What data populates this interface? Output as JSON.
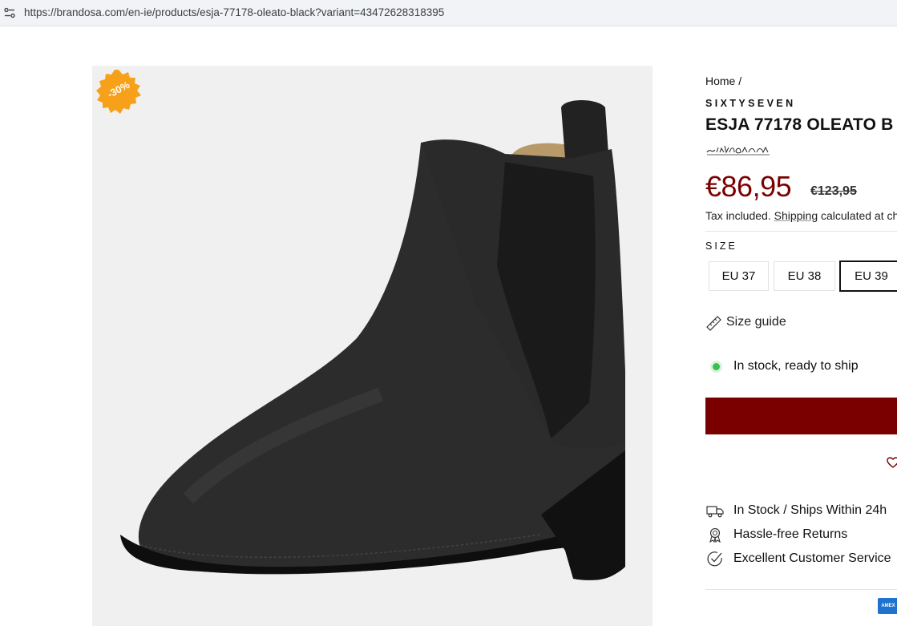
{
  "browser": {
    "url": "https://brandosa.com/en-ie/products/esja-77178-oleato-black?variant=43472628318395",
    "site_icon": "site-settings-icon"
  },
  "product_image": {
    "alt": "black chelsea boot",
    "discount_badge": "-30%",
    "badge_color": "#f7a11a"
  },
  "breadcrumb": {
    "home": "Home /"
  },
  "product": {
    "vendor": "SIXTYSEVEN",
    "title": "ESJA 77178 OLEATO B",
    "price": "€86,95",
    "compare_price": "€123,95",
    "tax_note_prefix": "Tax included.",
    "tax_note_link": "Shipping",
    "tax_note_suffix": "calculated at ch",
    "price_color": "#7a0000"
  },
  "size": {
    "label": "SIZE",
    "options": [
      "EU 37",
      "EU 38",
      "EU 39"
    ],
    "selected": "EU 39",
    "guide_label": "Size guide"
  },
  "availability": {
    "text": "In stock, ready to ship",
    "status_color": "#3dbf4f"
  },
  "add_to_cart": {
    "color": "#7a0000"
  },
  "features": [
    {
      "icon": "truck-icon",
      "label": "In Stock / Ships Within 24h"
    },
    {
      "icon": "award-icon",
      "label": "Hassle-free Returns"
    },
    {
      "icon": "check-circle-icon",
      "label": "Excellent Customer Service"
    }
  ],
  "payment": {
    "icon": "amex-icon",
    "label": "AMEX"
  }
}
